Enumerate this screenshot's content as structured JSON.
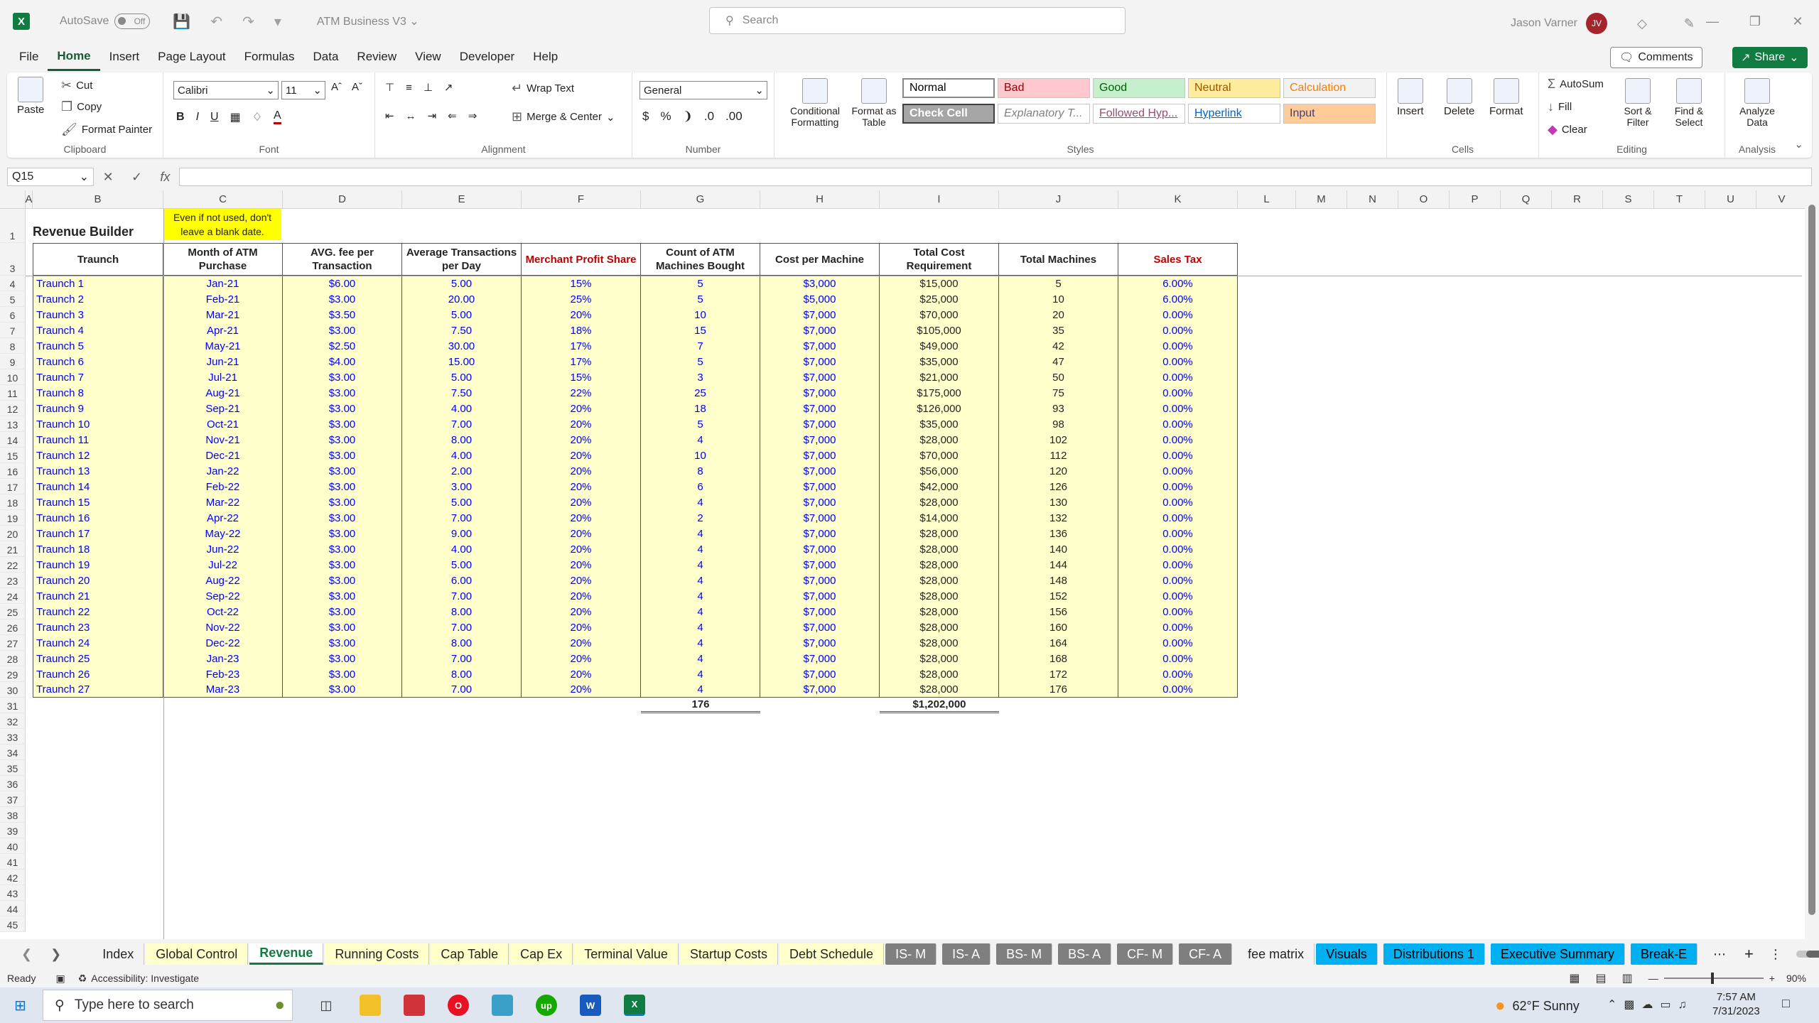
{
  "app": {
    "autosave_label": "AutoSave",
    "autosave_state": "Off",
    "doc_title": "ATM Business V3",
    "search_placeholder": "Search",
    "user_name": "Jason Varner",
    "user_initials": "JV"
  },
  "menu": [
    "File",
    "Home",
    "Insert",
    "Page Layout",
    "Formulas",
    "Data",
    "Review",
    "View",
    "Developer",
    "Help"
  ],
  "menu_active": "Home",
  "comments_label": "Comments",
  "share_label": "Share",
  "ribbon": {
    "clipboard": {
      "paste": "Paste",
      "cut": "Cut",
      "copy": "Copy",
      "format_painter": "Format Painter",
      "label": "Clipboard"
    },
    "font": {
      "name": "Calibri",
      "size": "11",
      "label": "Font",
      "bold": "B",
      "italic": "I",
      "underline": "U"
    },
    "alignment": {
      "wrap": "Wrap Text",
      "merge": "Merge & Center",
      "label": "Alignment"
    },
    "number": {
      "format": "General",
      "label": "Number"
    },
    "styles": {
      "cond_fmt": "Conditional Formatting",
      "fmt_table": "Format as Table",
      "label": "Styles",
      "cells": [
        {
          "name": "Normal",
          "bg": "#ffffff",
          "fg": "#000000"
        },
        {
          "name": "Bad",
          "bg": "#ffc7ce",
          "fg": "#9c0006"
        },
        {
          "name": "Good",
          "bg": "#c6efce",
          "fg": "#006100"
        },
        {
          "name": "Neutral",
          "bg": "#ffeb9c",
          "fg": "#9c5700"
        },
        {
          "name": "Calculation",
          "bg": "#f2f2f2",
          "fg": "#fa7d00"
        },
        {
          "name": "Check Cell",
          "bg": "#a5a5a5",
          "fg": "#ffffff"
        },
        {
          "name": "Explanatory T...",
          "bg": "#ffffff",
          "fg": "#7f7f7f"
        },
        {
          "name": "Followed Hyp...",
          "bg": "#ffffff",
          "fg": "#954f72"
        },
        {
          "name": "Hyperlink",
          "bg": "#ffffff",
          "fg": "#0563c1"
        },
        {
          "name": "Input",
          "bg": "#ffcc99",
          "fg": "#3f3f76"
        }
      ]
    },
    "cells": {
      "insert": "Insert",
      "delete": "Delete",
      "format": "Format",
      "label": "Cells"
    },
    "editing": {
      "autosum": "AutoSum",
      "fill": "Fill",
      "clear": "Clear",
      "sort": "Sort & Filter",
      "find": "Find & Select",
      "label": "Editing"
    },
    "analysis": {
      "analyze": "Analyze Data",
      "label": "Analysis"
    }
  },
  "namebox": "Q15",
  "fx_label": "fx",
  "columns": [
    "A",
    "B",
    "C",
    "D",
    "E",
    "F",
    "G",
    "H",
    "I",
    "J",
    "K",
    "L",
    "M",
    "N",
    "O",
    "P",
    "Q",
    "R",
    "S",
    "T",
    "U",
    "V"
  ],
  "sheet": {
    "title": "Revenue Builder",
    "note": "Even if not used, don't leave a blank date.",
    "headers": [
      "Traunch",
      "Month of ATM Purchase",
      "AVG. fee per Transaction",
      "Average Transactions per Day",
      "Merchant Profit Share",
      "Count of ATM Machines Bought",
      "Cost per Machine",
      "Total Cost Requirement",
      "Total Machines",
      "Sales Tax"
    ],
    "rows": [
      [
        "Traunch 1",
        "Jan-21",
        "$6.00",
        "5.00",
        "15%",
        "5",
        "$3,000",
        "$15,000",
        "5",
        "6.00%"
      ],
      [
        "Traunch 2",
        "Feb-21",
        "$3.00",
        "20.00",
        "25%",
        "5",
        "$5,000",
        "$25,000",
        "10",
        "6.00%"
      ],
      [
        "Traunch 3",
        "Mar-21",
        "$3.50",
        "5.00",
        "20%",
        "10",
        "$7,000",
        "$70,000",
        "20",
        "0.00%"
      ],
      [
        "Traunch 4",
        "Apr-21",
        "$3.00",
        "7.50",
        "18%",
        "15",
        "$7,000",
        "$105,000",
        "35",
        "0.00%"
      ],
      [
        "Traunch 5",
        "May-21",
        "$2.50",
        "30.00",
        "17%",
        "7",
        "$7,000",
        "$49,000",
        "42",
        "0.00%"
      ],
      [
        "Traunch 6",
        "Jun-21",
        "$4.00",
        "15.00",
        "17%",
        "5",
        "$7,000",
        "$35,000",
        "47",
        "0.00%"
      ],
      [
        "Traunch 7",
        "Jul-21",
        "$3.00",
        "5.00",
        "15%",
        "3",
        "$7,000",
        "$21,000",
        "50",
        "0.00%"
      ],
      [
        "Traunch 8",
        "Aug-21",
        "$3.00",
        "7.50",
        "22%",
        "25",
        "$7,000",
        "$175,000",
        "75",
        "0.00%"
      ],
      [
        "Traunch 9",
        "Sep-21",
        "$3.00",
        "4.00",
        "20%",
        "18",
        "$7,000",
        "$126,000",
        "93",
        "0.00%"
      ],
      [
        "Traunch 10",
        "Oct-21",
        "$3.00",
        "7.00",
        "20%",
        "5",
        "$7,000",
        "$35,000",
        "98",
        "0.00%"
      ],
      [
        "Traunch 11",
        "Nov-21",
        "$3.00",
        "8.00",
        "20%",
        "4",
        "$7,000",
        "$28,000",
        "102",
        "0.00%"
      ],
      [
        "Traunch 12",
        "Dec-21",
        "$3.00",
        "4.00",
        "20%",
        "10",
        "$7,000",
        "$70,000",
        "112",
        "0.00%"
      ],
      [
        "Traunch 13",
        "Jan-22",
        "$3.00",
        "2.00",
        "20%",
        "8",
        "$7,000",
        "$56,000",
        "120",
        "0.00%"
      ],
      [
        "Traunch 14",
        "Feb-22",
        "$3.00",
        "3.00",
        "20%",
        "6",
        "$7,000",
        "$42,000",
        "126",
        "0.00%"
      ],
      [
        "Traunch 15",
        "Mar-22",
        "$3.00",
        "5.00",
        "20%",
        "4",
        "$7,000",
        "$28,000",
        "130",
        "0.00%"
      ],
      [
        "Traunch 16",
        "Apr-22",
        "$3.00",
        "7.00",
        "20%",
        "2",
        "$7,000",
        "$14,000",
        "132",
        "0.00%"
      ],
      [
        "Traunch 17",
        "May-22",
        "$3.00",
        "9.00",
        "20%",
        "4",
        "$7,000",
        "$28,000",
        "136",
        "0.00%"
      ],
      [
        "Traunch 18",
        "Jun-22",
        "$3.00",
        "4.00",
        "20%",
        "4",
        "$7,000",
        "$28,000",
        "140",
        "0.00%"
      ],
      [
        "Traunch 19",
        "Jul-22",
        "$3.00",
        "5.00",
        "20%",
        "4",
        "$7,000",
        "$28,000",
        "144",
        "0.00%"
      ],
      [
        "Traunch 20",
        "Aug-22",
        "$3.00",
        "6.00",
        "20%",
        "4",
        "$7,000",
        "$28,000",
        "148",
        "0.00%"
      ],
      [
        "Traunch 21",
        "Sep-22",
        "$3.00",
        "7.00",
        "20%",
        "4",
        "$7,000",
        "$28,000",
        "152",
        "0.00%"
      ],
      [
        "Traunch 22",
        "Oct-22",
        "$3.00",
        "8.00",
        "20%",
        "4",
        "$7,000",
        "$28,000",
        "156",
        "0.00%"
      ],
      [
        "Traunch 23",
        "Nov-22",
        "$3.00",
        "7.00",
        "20%",
        "4",
        "$7,000",
        "$28,000",
        "160",
        "0.00%"
      ],
      [
        "Traunch 24",
        "Dec-22",
        "$3.00",
        "8.00",
        "20%",
        "4",
        "$7,000",
        "$28,000",
        "164",
        "0.00%"
      ],
      [
        "Traunch 25",
        "Jan-23",
        "$3.00",
        "7.00",
        "20%",
        "4",
        "$7,000",
        "$28,000",
        "168",
        "0.00%"
      ],
      [
        "Traunch 26",
        "Feb-23",
        "$3.00",
        "8.00",
        "20%",
        "4",
        "$7,000",
        "$28,000",
        "172",
        "0.00%"
      ],
      [
        "Traunch 27",
        "Mar-23",
        "$3.00",
        "7.00",
        "20%",
        "4",
        "$7,000",
        "$28,000",
        "176",
        "0.00%"
      ]
    ],
    "total_machines": "176",
    "total_cost": "$1,202,000",
    "row_numbers": [
      "1",
      "3",
      "4",
      "5",
      "6",
      "7",
      "8",
      "9",
      "10",
      "11",
      "12",
      "13",
      "14",
      "15",
      "16",
      "17",
      "18",
      "19",
      "20",
      "21",
      "22",
      "23",
      "24",
      "25",
      "26",
      "27",
      "28",
      "29",
      "30",
      "31",
      "32",
      "33",
      "34",
      "35",
      "36",
      "37",
      "38",
      "39",
      "40",
      "41",
      "42",
      "43",
      "44",
      "45"
    ]
  },
  "tabs": [
    {
      "name": "Index",
      "style": "plain"
    },
    {
      "name": "Global Control",
      "style": "y"
    },
    {
      "name": "Revenue",
      "style": "active"
    },
    {
      "name": "Running Costs",
      "style": "y"
    },
    {
      "name": "Cap Table",
      "style": "y"
    },
    {
      "name": "Cap Ex",
      "style": "y"
    },
    {
      "name": "Terminal Value",
      "style": "y"
    },
    {
      "name": "Startup Costs",
      "style": "y"
    },
    {
      "name": "Debt Schedule",
      "style": "y"
    },
    {
      "name": "IS- M",
      "style": "gray"
    },
    {
      "name": "IS- A",
      "style": "gray"
    },
    {
      "name": "BS- M",
      "style": "gray"
    },
    {
      "name": "BS- A",
      "style": "gray"
    },
    {
      "name": "CF- M",
      "style": "gray"
    },
    {
      "name": "CF- A",
      "style": "gray"
    },
    {
      "name": "fee matrix",
      "style": "plain"
    },
    {
      "name": "Visuals",
      "style": "blue"
    },
    {
      "name": "Distributions 1",
      "style": "blue"
    },
    {
      "name": "Executive Summary",
      "style": "blue"
    },
    {
      "name": "Break-E",
      "style": "blue"
    }
  ],
  "status": {
    "ready": "Ready",
    "accessibility": "Accessibility: Investigate",
    "zoom": "90%"
  },
  "taskbar": {
    "search": "Type here to search",
    "weather": "62°F  Sunny",
    "time": "7:57 AM",
    "date": "7/31/2023"
  }
}
